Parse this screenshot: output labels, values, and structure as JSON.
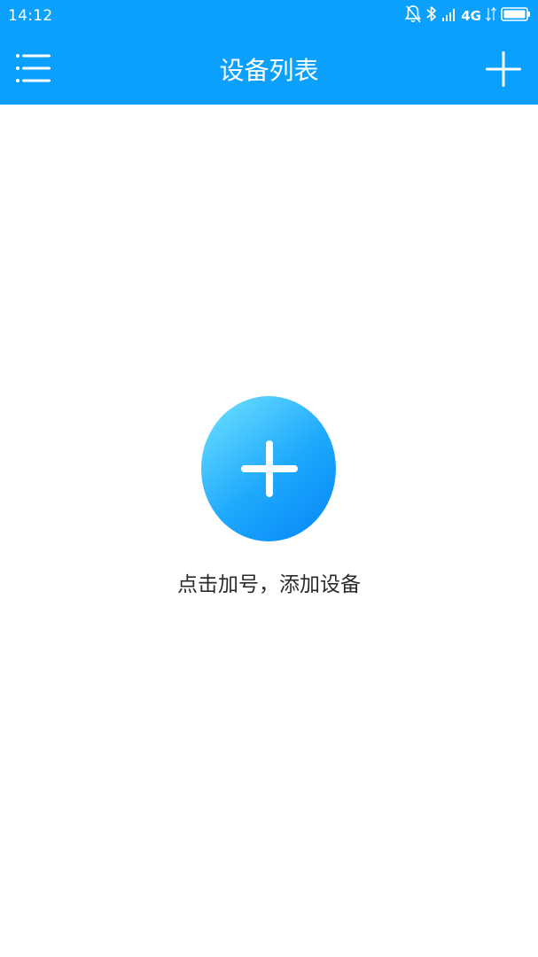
{
  "status_bar": {
    "time": "14:12",
    "network": "4G",
    "icons": [
      "bell-off-icon",
      "bluetooth-icon",
      "signal-icon",
      "data-activity-icon",
      "battery-icon"
    ]
  },
  "header": {
    "title": "设备列表",
    "background_color": "#0ba0fb",
    "left_icon": "menu-icon",
    "right_icon": "add-icon"
  },
  "empty_state": {
    "message": "点击加号，添加设备",
    "button_icon": "plus-icon",
    "button_gradient": [
      "#5fd6ff",
      "#0a8ef8"
    ]
  }
}
